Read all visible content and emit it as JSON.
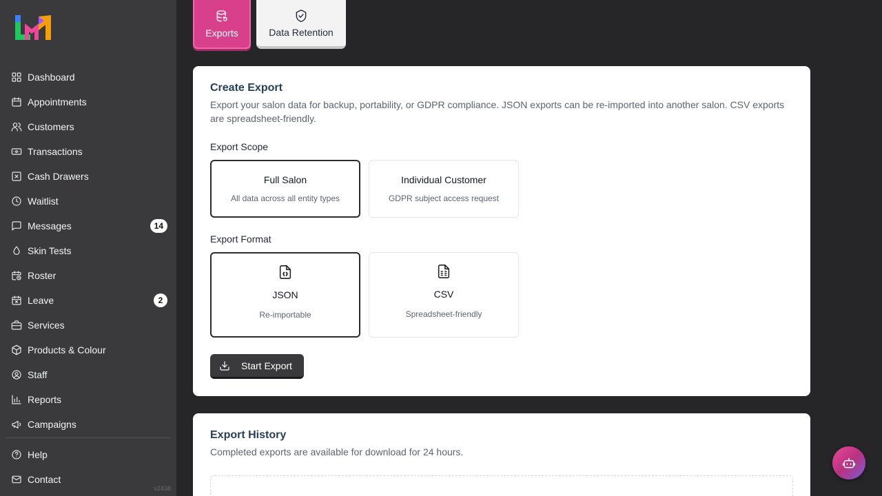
{
  "colors": {
    "sidebar": "#3a3a3c",
    "accent": "#d9408b",
    "background": "#262628",
    "title": "#274059"
  },
  "sidebar": {
    "items": [
      {
        "label": "Dashboard",
        "icon": "grid-icon"
      },
      {
        "label": "Appointments",
        "icon": "calendar-icon"
      },
      {
        "label": "Customers",
        "icon": "users-icon"
      },
      {
        "label": "Transactions",
        "icon": "banknote-icon"
      },
      {
        "label": "Cash Drawers",
        "icon": "square-x-icon"
      },
      {
        "label": "Waitlist",
        "icon": "clock-icon"
      },
      {
        "label": "Messages",
        "icon": "message-icon",
        "badge": "14"
      },
      {
        "label": "Skin Tests",
        "icon": "droplet-icon"
      },
      {
        "label": "Roster",
        "icon": "calendar-clock-icon"
      },
      {
        "label": "Leave",
        "icon": "calendar-x-icon",
        "badge": "2"
      },
      {
        "label": "Services",
        "icon": "briefcase-icon"
      },
      {
        "label": "Products & Colour",
        "icon": "package-icon"
      },
      {
        "label": "Staff",
        "icon": "user-circle-icon"
      },
      {
        "label": "Reports",
        "icon": "bar-chart-icon"
      },
      {
        "label": "Campaigns",
        "icon": "megaphone-icon"
      }
    ],
    "bottom": [
      {
        "label": "Help",
        "icon": "help-circle-icon"
      },
      {
        "label": "Contact",
        "icon": "mail-icon"
      }
    ],
    "version": "v2438"
  },
  "tabs": [
    {
      "label": "Exports",
      "icon": "database-icon"
    },
    {
      "label": "Data Retention",
      "icon": "shield-check-icon"
    }
  ],
  "create_export": {
    "title": "Create Export",
    "description": "Export your salon data for backup, portability, or GDPR compliance. JSON exports can be re-imported into another salon. CSV exports are spreadsheet-friendly.",
    "scope_label": "Export Scope",
    "scope_options": [
      {
        "title": "Full Salon",
        "subtitle": "All data across all entity types"
      },
      {
        "title": "Individual Customer",
        "subtitle": "GDPR subject access request"
      }
    ],
    "format_label": "Export Format",
    "format_options": [
      {
        "title": "JSON",
        "subtitle": "Re-importable",
        "icon": "file-json-icon"
      },
      {
        "title": "CSV",
        "subtitle": "Spreadsheet-friendly",
        "icon": "file-spreadsheet-icon"
      }
    ],
    "start_button": "Start Export"
  },
  "export_history": {
    "title": "Export History",
    "description": "Completed exports are available for download for 24 hours."
  },
  "assistant": {
    "icon": "bot-icon"
  }
}
